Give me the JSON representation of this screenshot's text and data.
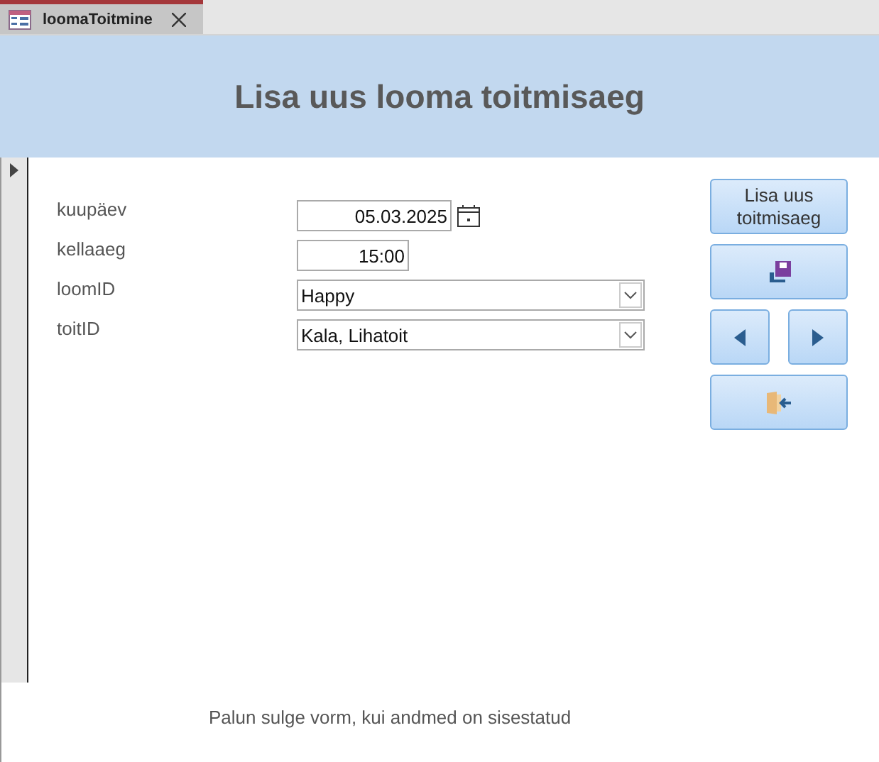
{
  "tab": {
    "title": "loomaToitmine"
  },
  "header": {
    "title": "Lisa uus looma toitmisaeg"
  },
  "fields": [
    {
      "label": "kuupäev",
      "kind": "date",
      "value": "05.03.2025"
    },
    {
      "label": "kellaaeg",
      "kind": "time",
      "value": "15:00"
    },
    {
      "label": "loomID",
      "kind": "combo",
      "value": "Happy"
    },
    {
      "label": "toitID",
      "kind": "combo",
      "value": "Kala, Lihatoit"
    }
  ],
  "buttons": [
    {
      "kind": "text",
      "label": "Lisa uus toitmisaeg"
    },
    {
      "kind": "save"
    },
    {
      "kind": "prev"
    },
    {
      "kind": "next"
    },
    {
      "kind": "exit"
    }
  ],
  "footer": {
    "note": "Palun sulge vorm, kui andmed on sisestatud"
  }
}
